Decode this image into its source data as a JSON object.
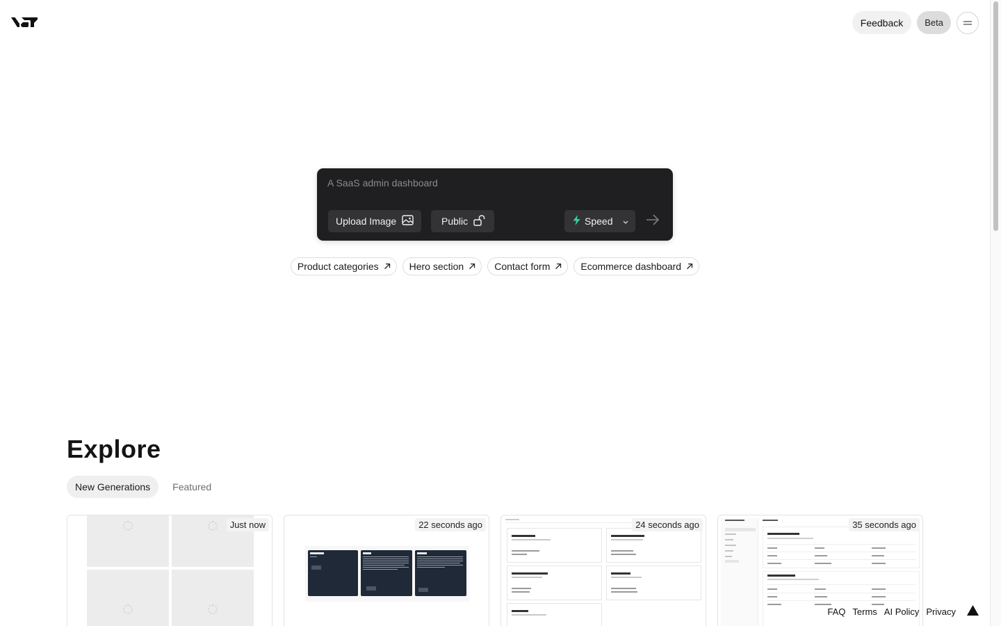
{
  "header": {
    "logo_icon": "v0-logo-icon",
    "feedback_label": "Feedback",
    "beta_label": "Beta",
    "menu_icon": "menu-icon"
  },
  "prompt": {
    "placeholder": "A SaaS admin dashboard",
    "value": "",
    "upload_label": "Upload Image",
    "upload_icon": "image-icon",
    "visibility_label": "Public",
    "visibility_icon": "unlock-icon",
    "model_label": "Speed",
    "model_icon": "lightning-icon",
    "model_icon_color": "#34d399",
    "send_icon": "arrow-right-icon"
  },
  "suggestions": [
    {
      "label": "Product categories",
      "icon": "arrow-up-right-icon"
    },
    {
      "label": "Hero section",
      "icon": "arrow-up-right-icon"
    },
    {
      "label": "Contact form",
      "icon": "arrow-up-right-icon"
    },
    {
      "label": "Ecommerce dashboard",
      "icon": "arrow-up-right-icon"
    }
  ],
  "explore": {
    "title": "Explore",
    "tabs": [
      {
        "label": "New Generations",
        "active": true
      },
      {
        "label": "Featured",
        "active": false
      }
    ],
    "cards": [
      {
        "time": "Just now",
        "preview": "loading"
      },
      {
        "time": "22 seconds ago",
        "preview": "dark-panels"
      },
      {
        "time": "24 seconds ago",
        "preview": "steps"
      },
      {
        "time": "35 seconds ago",
        "preview": "services-table"
      }
    ]
  },
  "footer": {
    "links": [
      "FAQ",
      "Terms",
      "AI Policy",
      "Privacy"
    ],
    "brand_icon": "vercel-triangle-icon"
  }
}
